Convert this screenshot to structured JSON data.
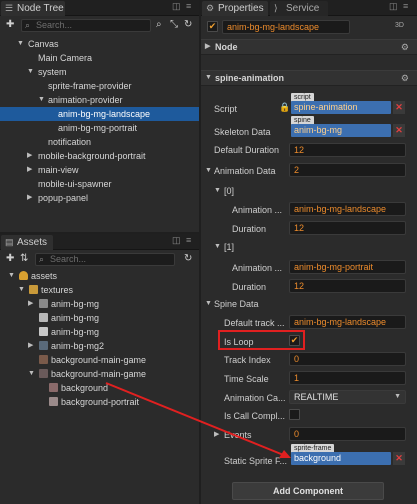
{
  "node_tree": {
    "tab_label": "Node Tree",
    "search_placeholder": "Search...",
    "items": [
      {
        "label": "Canvas"
      },
      {
        "label": "Main Camera"
      },
      {
        "label": "system"
      },
      {
        "label": "sprite-frame-provider"
      },
      {
        "label": "animation-provider"
      },
      {
        "label": "anim-bg-mg-landscape"
      },
      {
        "label": "anim-bg-mg-portrait"
      },
      {
        "label": "notification"
      },
      {
        "label": "mobile-background-portrait"
      },
      {
        "label": "main-view"
      },
      {
        "label": "mobile-ui-spawner"
      },
      {
        "label": "popup-panel"
      }
    ]
  },
  "assets": {
    "tab_label": "Assets",
    "search_placeholder": "Search...",
    "items": [
      {
        "label": "assets"
      },
      {
        "label": "textures"
      },
      {
        "label": "anim-bg-mg"
      },
      {
        "label": "anim-bg-mg"
      },
      {
        "label": "anim-bg-mg"
      },
      {
        "label": "anim-bg-mg2"
      },
      {
        "label": "background-main-game"
      },
      {
        "label": "background-main-game"
      },
      {
        "label": "background"
      },
      {
        "label": "background-portrait"
      }
    ]
  },
  "properties": {
    "tab_label": "Properties",
    "service_tab_label": "Service",
    "node_name": "anim-bg-mg-landscape",
    "badge_3d": "3D",
    "node_section": "Node",
    "component_section": "spine-animation",
    "script_tag": "script",
    "script_label": "Script",
    "script_value": "spine-animation",
    "skeleton_tag": "spine",
    "skeleton_label": "Skeleton Data",
    "skeleton_value": "anim-bg-mg",
    "default_duration_label": "Default Duration",
    "default_duration_value": "12",
    "animation_data_label": "Animation Data",
    "animation_data_value": "2",
    "item0_label": "[0]",
    "item0_anim_label": "Animation ...",
    "item0_anim_value": "anim-bg-mg-landscape",
    "item0_duration_label": "Duration",
    "item0_duration_value": "12",
    "item1_label": "[1]",
    "item1_anim_label": "Animation ...",
    "item1_anim_value": "anim-bg-mg-portrait",
    "item1_duration_label": "Duration",
    "item1_duration_value": "12",
    "spine_data_label": "Spine Data",
    "default_track_label": "Default track ...",
    "default_track_value": "anim-bg-mg-landscape",
    "is_loop_label": "Is Loop",
    "is_loop_checked": true,
    "track_index_label": "Track Index",
    "track_index_value": "0",
    "time_scale_label": "Time Scale",
    "time_scale_value": "1",
    "animation_ca_label": "Animation Ca...",
    "animation_ca_value": "REALTIME",
    "is_call_label": "Is Call Compl...",
    "is_call_checked": false,
    "events_label": "Events",
    "events_value": "0",
    "sprite_tag": "sprite-frame",
    "static_sprite_label": "Static Sprite F...",
    "static_sprite_value": "background",
    "add_component_label": "Add Component"
  },
  "colors": {
    "selection": "#1e5a9c",
    "highlight": "#e02020",
    "field_text": "#ec8b2c",
    "object_field": "#3c6fb0"
  }
}
